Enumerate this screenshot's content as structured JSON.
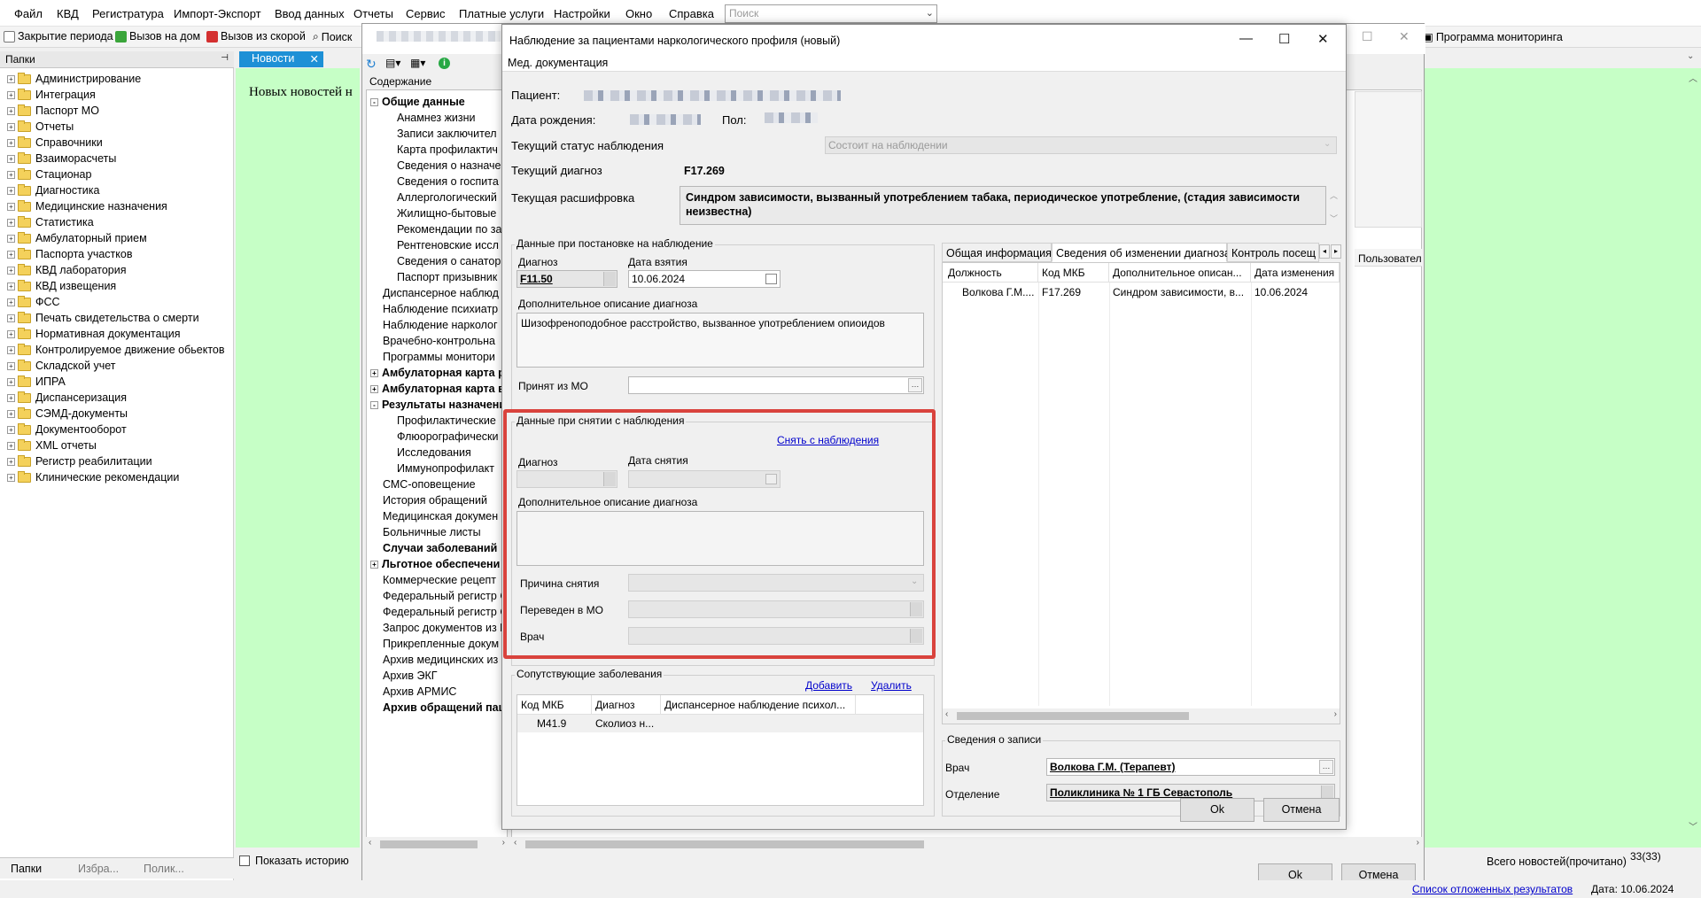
{
  "menu": [
    "Файл",
    "КВД",
    "Регистратура",
    "Импорт-Экспорт",
    "Ввод данных",
    "Отчеты",
    "Сервис",
    "Платные услуги",
    "Настройки",
    "Окно",
    "Справка"
  ],
  "search": {
    "placeholder": "Поиск"
  },
  "toolbar": {
    "close_period": "Закрытие периода",
    "home_call": "Вызов на дом",
    "ambulance_call": "Вызов из скорой",
    "search": "Поиск",
    "monitoring": "Программа мониторинга"
  },
  "left_panel": {
    "header": "Папки",
    "items": [
      "Администрирование",
      "Интеграция",
      "Паспорт МО",
      "Отчеты",
      "Справочники",
      "Взаиморасчеты",
      "Стационар",
      "Диагностика",
      "Медицинские назначения",
      "Статистика",
      "Амбулаторный прием",
      "Паспорта участков",
      "КВД лаборатория",
      "КВД извещения",
      "ФСС",
      "Печать свидетельства о смерти",
      "Нормативная документация",
      "Контролируемое движение обьектов",
      "Складской учет",
      "ИПРА",
      "Диспансеризация",
      "СЭМД-документы",
      "Документооборот",
      "XML отчеты",
      "Регистр реабилитации",
      "Клинические рекомендации"
    ],
    "tabs": [
      "Папки",
      "Избра...",
      "Полик..."
    ]
  },
  "news": {
    "tab": "Новости",
    "text": "Новых новостей н",
    "show_history": "Показать историю",
    "total": "Всего новостей(прочитано)",
    "count": "33(33)"
  },
  "med_docs": {
    "content_header": "Содержание",
    "tree": [
      {
        "t": "Общие данные",
        "b": true,
        "exp": "−",
        "lvl": 0
      },
      {
        "t": "Анамнез жизни",
        "lvl": 1
      },
      {
        "t": "Записи заключител",
        "lvl": 1
      },
      {
        "t": "Карта профилактич",
        "lvl": 1
      },
      {
        "t": "Сведения о назначе",
        "lvl": 1
      },
      {
        "t": "Сведения о госпита",
        "lvl": 1
      },
      {
        "t": "Аллергологический",
        "lvl": 1
      },
      {
        "t": "Жилищно-бытовые",
        "lvl": 1
      },
      {
        "t": "Рекомендации по за",
        "lvl": 1
      },
      {
        "t": "Рентгеновские иссл",
        "lvl": 1
      },
      {
        "t": "Сведения о санатор",
        "lvl": 1
      },
      {
        "t": "Паспорт призывник",
        "lvl": 1
      },
      {
        "t": "Диспансерное наблюд",
        "lvl": 0
      },
      {
        "t": "Наблюдение психиатр",
        "lvl": 0
      },
      {
        "t": "Наблюдение нарколог",
        "lvl": 0
      },
      {
        "t": "Врачебно-контрольна",
        "lvl": 0
      },
      {
        "t": "Программы монитори",
        "lvl": 0
      },
      {
        "t": "Амбулаторная карта ре",
        "b": true,
        "exp": "+",
        "lvl": 0
      },
      {
        "t": "Амбулаторная карта вз",
        "b": true,
        "exp": "+",
        "lvl": 0
      },
      {
        "t": "Результаты назначени",
        "b": true,
        "exp": "−",
        "lvl": 0
      },
      {
        "t": "Профилактические",
        "lvl": 1
      },
      {
        "t": "Флюорографически",
        "lvl": 1
      },
      {
        "t": "Исследования",
        "lvl": 1
      },
      {
        "t": "Иммунопрофилакт",
        "lvl": 1
      },
      {
        "t": "СМС-оповещение",
        "lvl": 0
      },
      {
        "t": "История обращений",
        "lvl": 0
      },
      {
        "t": "Медицинская докумен",
        "lvl": 0
      },
      {
        "t": "Больничные листы",
        "lvl": 0
      },
      {
        "t": "Случаи заболеваний",
        "b": true,
        "lvl": 0
      },
      {
        "t": "Льготное обеспечени",
        "b": true,
        "exp": "+",
        "lvl": 0
      },
      {
        "t": "Коммерческие рецепт",
        "lvl": 0
      },
      {
        "t": "Федеральный регистр С",
        "lvl": 0
      },
      {
        "t": "Федеральный регистр С",
        "lvl": 0
      },
      {
        "t": "Запрос документов из Р",
        "lvl": 0
      },
      {
        "t": "Прикрепленные докум",
        "lvl": 0
      },
      {
        "t": "Архив медицинских из",
        "lvl": 0
      },
      {
        "t": "Архив ЭКГ",
        "lvl": 0
      },
      {
        "t": "Архив АРМИС",
        "lvl": 0
      },
      {
        "t": "Архив обращений пац",
        "b": true,
        "lvl": 0
      }
    ],
    "user_col": "Пользовател",
    "ok": "Ok",
    "cancel": "Отмена"
  },
  "dialog": {
    "title": "Наблюдение за пациентами наркологического профиля (новый)",
    "tab": "Мед. документация",
    "patient_label": "Пациент:",
    "dob_label": "Дата рождения:",
    "sex_label": "Пол:",
    "status_label": "Текущий статус наблюдения",
    "status_value": "Состоит на наблюдении",
    "diag_label": "Текущий диагноз",
    "diag_value": "F17.269",
    "decode_label": "Текущая расшифровка",
    "decode_value": "Синдром зависимости, вызванный употреблением табака, периодическое употребление, (стадия зависимости неизвестна)",
    "reg": {
      "title": "Данные при постановке на наблюдение",
      "diag_label": "Диагноз",
      "diag_value": "F11.50",
      "date_label": "Дата взятия",
      "date_value": "10.06.2024",
      "desc_label": "Дополнительное описание диагноза",
      "desc_value": "Шизофреноподобное расстройство, вызванное употреблением опиоидов",
      "from_mo_label": "Принят из МО"
    },
    "removal": {
      "title": "Данные при снятии с наблюдения",
      "action": "Снять с наблюдения",
      "diag_label": "Диагноз",
      "date_label": "Дата снятия",
      "desc_label": "Дополнительное описание диагноза",
      "reason_label": "Причина снятия",
      "moved_label": "Переведен в МО",
      "doctor_label": "Врач"
    },
    "comorbid": {
      "title": "Сопутствующие заболевания",
      "add": "Добавить",
      "delete": "Удалить",
      "columns": [
        "Код МКБ",
        "Диагноз",
        "Диспансерное наблюдение психол..."
      ],
      "rows": [
        [
          "M41.9",
          "Сколиоз н...",
          ""
        ]
      ]
    },
    "tabs": [
      "Общая информация",
      "Сведения об изменении диагноза",
      "Контроль посещ"
    ],
    "history": {
      "columns": [
        "Должность",
        "Код МКБ",
        "Дополнительное описан...",
        "Дата изменения"
      ],
      "rows": [
        [
          "Волкова Г.М....",
          "F17.269",
          "Синдром зависимости, в...",
          "10.06.2024"
        ]
      ]
    },
    "record": {
      "title": "Сведения о записи",
      "doctor_label": "Врач",
      "doctor_value": "Волкова Г.М. (Терапевт)",
      "dept_label": "Отделение",
      "dept_value": "Поликлиника № 1 ГБ Севастополь"
    },
    "ok": "Ok",
    "cancel": "Отмена"
  },
  "status": {
    "deferred": "Список отложенных результатов",
    "date": "Дата: 10.06.2024"
  },
  "colors": {
    "accent": "#1e90d6",
    "news_bg": "#c6ffc6",
    "highlight": "#d9433d",
    "link": "#0000cc"
  }
}
